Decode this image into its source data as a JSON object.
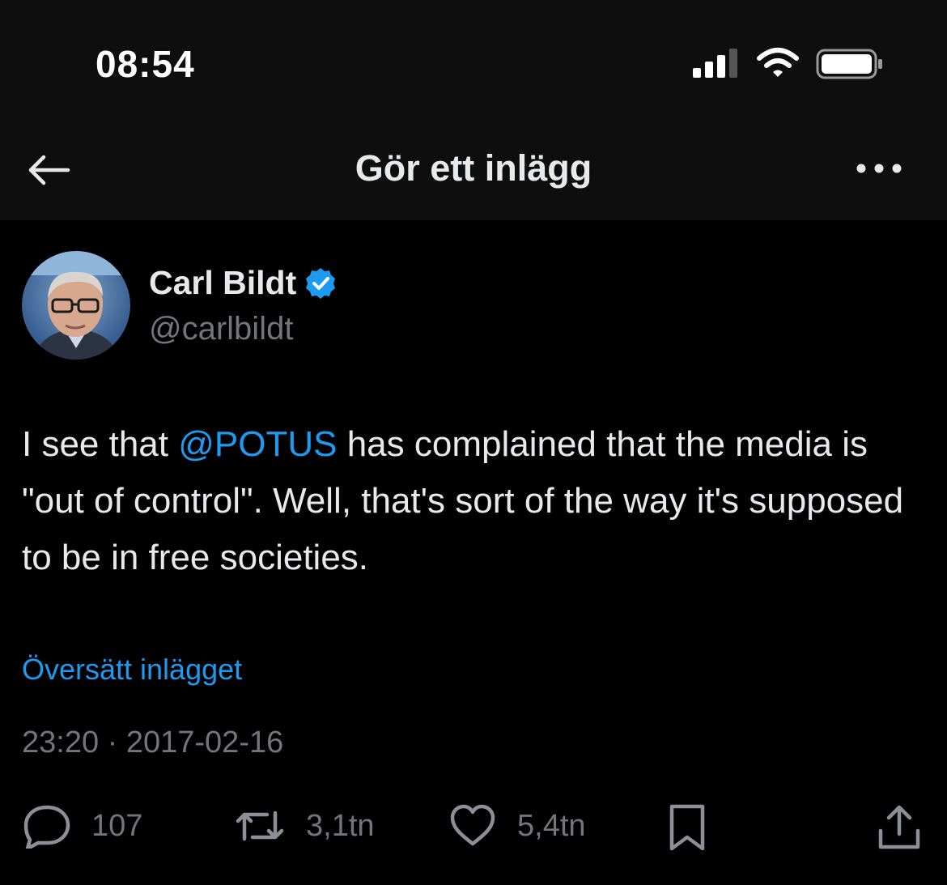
{
  "status_bar": {
    "time": "08:54"
  },
  "nav": {
    "title": "Gör ett inlägg"
  },
  "tweet": {
    "author_name": "Carl Bildt",
    "author_handle": "@carlbildt",
    "text_before": "I see that ",
    "mention": "@POTUS",
    "text_after": " has complained that the media is \"out of control\". Well, that's sort of the way it's supposed to be in free societies.",
    "translate_label": "Översätt inlägget",
    "timestamp": "23:20 · 2017-02-16",
    "replies": "107",
    "reposts": "3,1tn",
    "likes": "5,4tn"
  },
  "colors": {
    "accent": "#1d9bf0",
    "muted": "#71767b",
    "text": "#e7e9ea",
    "background": "#000000",
    "header": "#0e0e0e"
  },
  "icons": {
    "back": "arrow-left-icon",
    "more": "more-horizontal-icon",
    "verified": "verified-badge-icon",
    "reply": "reply-icon",
    "repost": "repost-icon",
    "like": "heart-icon",
    "bookmark": "bookmark-icon",
    "share": "share-icon"
  }
}
